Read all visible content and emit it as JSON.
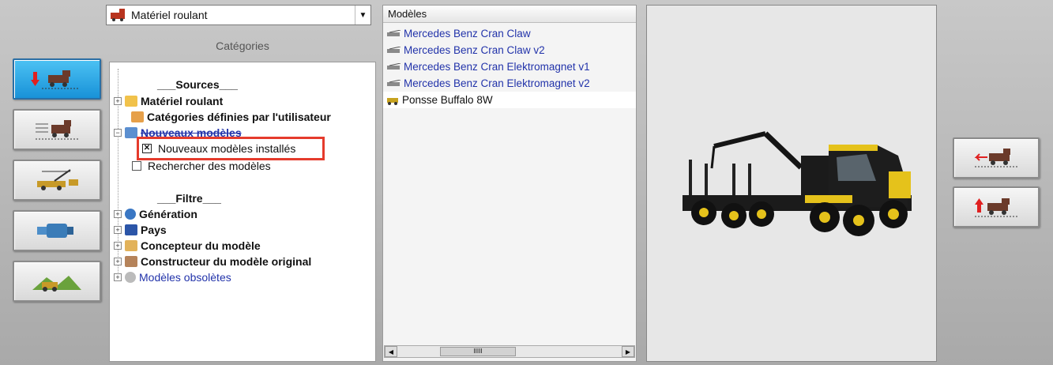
{
  "dropdown": {
    "selected": "Matériel roulant"
  },
  "categories": {
    "header": "Catégories",
    "items": [
      {
        "label": "___Sources___"
      },
      {
        "label": "Matériel roulant"
      },
      {
        "label": "Catégories définies par l'utilisateur"
      },
      {
        "label": "Nouveaux modèles"
      },
      {
        "label": "Nouveaux modèles installés"
      },
      {
        "label": "Rechercher des modèles"
      },
      {
        "label": "___Filtre___"
      },
      {
        "label": "Génération"
      },
      {
        "label": "Pays"
      },
      {
        "label": "Concepteur du modèle"
      },
      {
        "label": "Constructeur du modèle original"
      },
      {
        "label": "Modèles obsolètes"
      }
    ]
  },
  "models": {
    "header": "Modèles",
    "items": [
      {
        "label": "Mercedes Benz Cran Claw"
      },
      {
        "label": "Mercedes Benz Cran Claw v2"
      },
      {
        "label": "Mercedes Benz Cran Elektromagnet v1"
      },
      {
        "label": "Mercedes Benz Cran Elektromagnet v2"
      },
      {
        "label": "Ponsse Buffalo 8W"
      }
    ],
    "selected_index": 4
  },
  "colors": {
    "accent": "#1892d8",
    "highlight": "#e53b2c",
    "link": "#2233aa"
  }
}
